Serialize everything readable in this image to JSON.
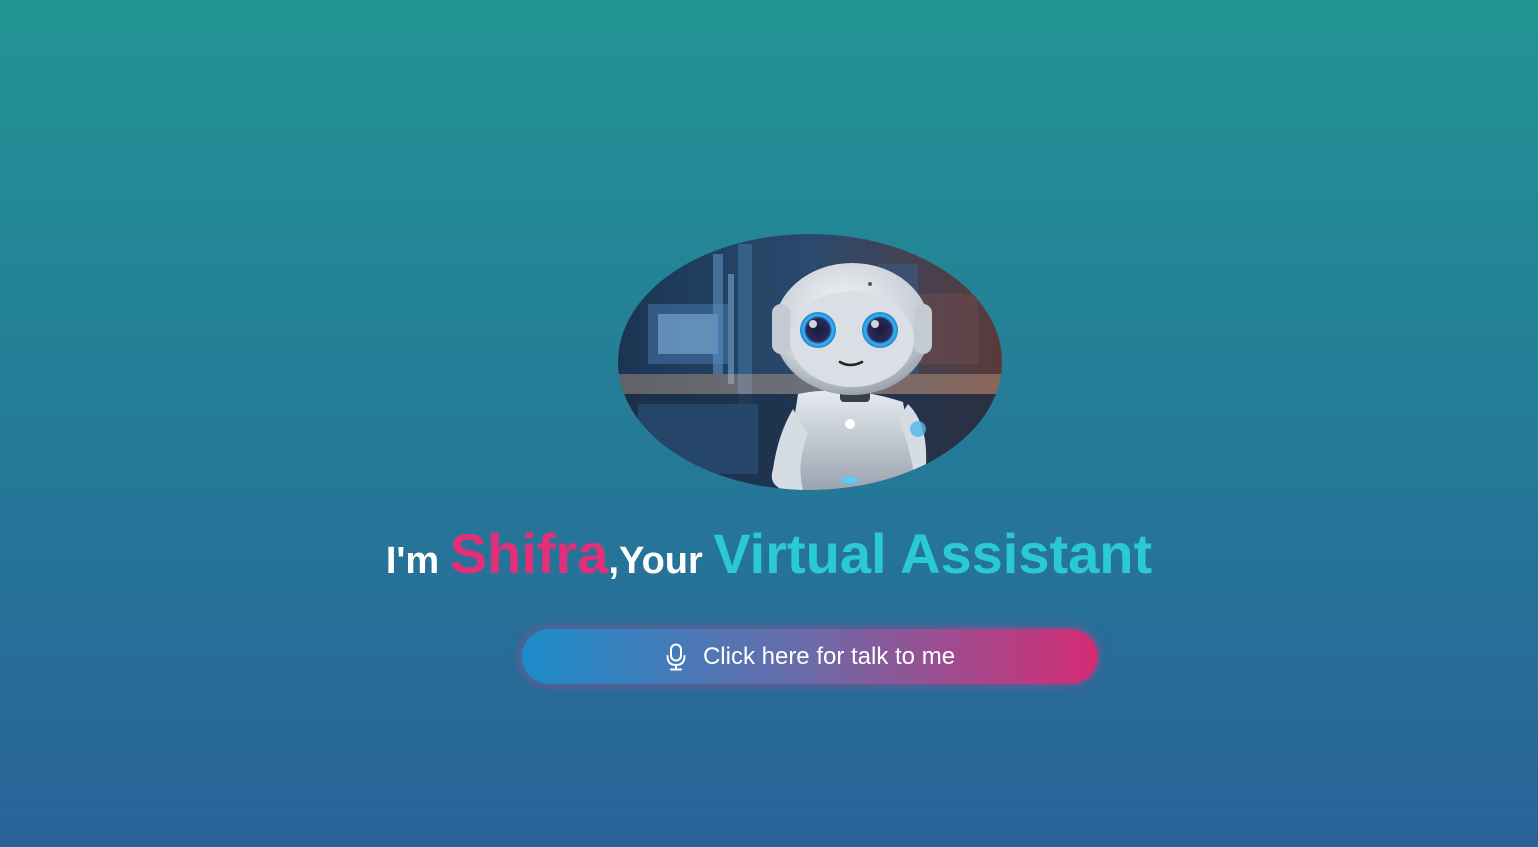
{
  "hero": {
    "avatar_icon": "robot-avatar",
    "headline": {
      "prefix": "I'm ",
      "name": "Shifra",
      "middle": ",Your ",
      "role": "Virtual Assistant"
    },
    "talk_button": {
      "icon": "microphone-icon",
      "label": "Click here for talk to me"
    }
  },
  "colors": {
    "background_top": "#229594",
    "background_bottom": "#2a6298",
    "name_accent": "#e0307a",
    "role_accent": "#2bc9d6",
    "button_start": "#1b8cc9",
    "button_end": "#d42c74"
  }
}
